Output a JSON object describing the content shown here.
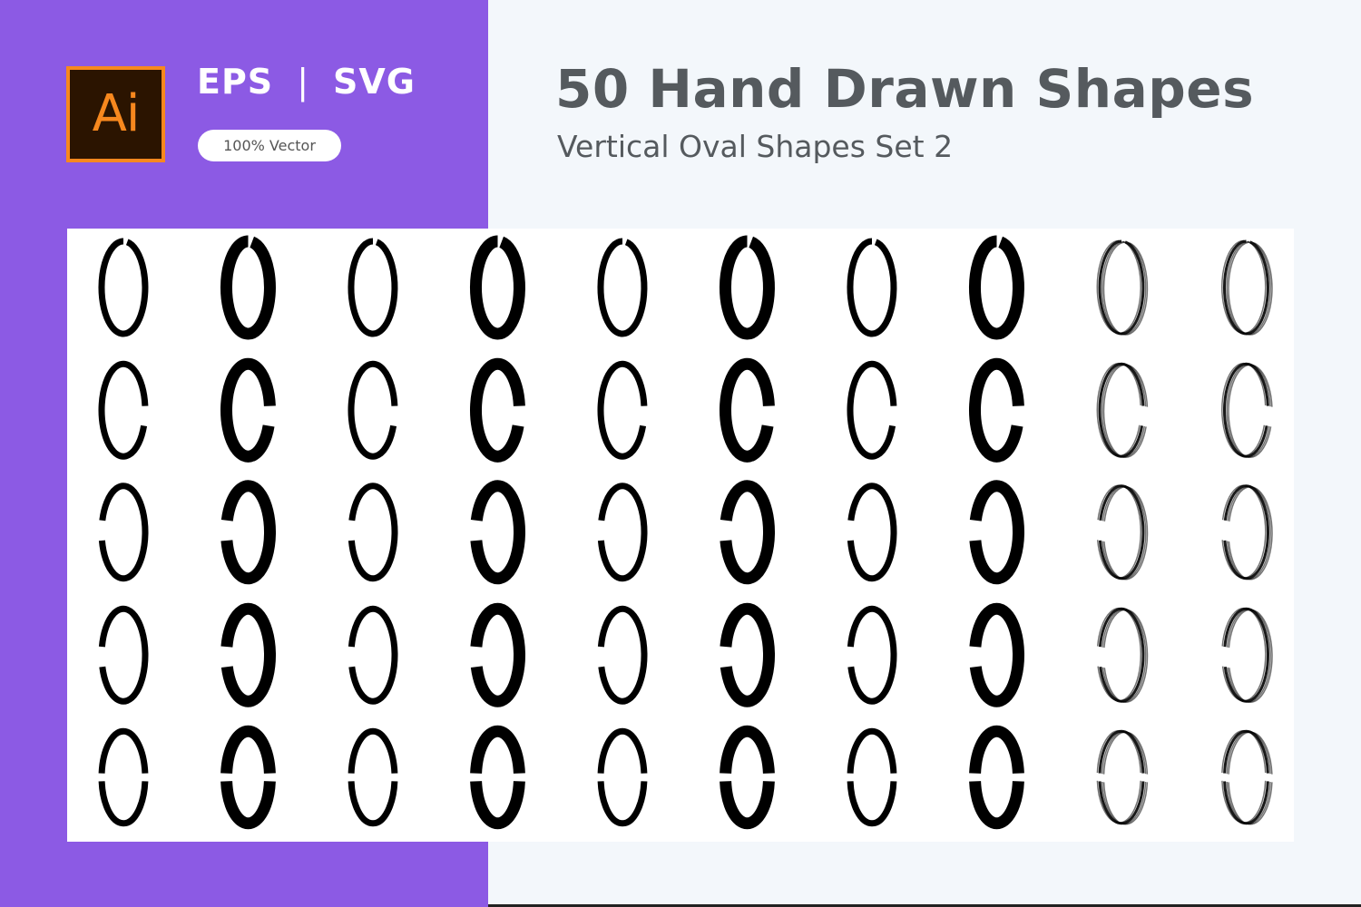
{
  "badge": {
    "logo_text": "Ai",
    "formats": [
      "EPS",
      "SVG"
    ],
    "separator": "|",
    "vector_pill": "100% Vector"
  },
  "header": {
    "title": "50 Hand Drawn Shapes",
    "subtitle": "Vertical Oval Shapes Set 2"
  },
  "colors": {
    "panel_purple": "#8c5ae4",
    "logo_orange": "#f7881e",
    "logo_dark": "#2b1400",
    "title_gray": "#555a5e",
    "page_bg": "#f3f7fb",
    "card_bg": "#ffffff",
    "shape_ink": "#000000"
  },
  "grid": {
    "rows": 5,
    "columns": 10,
    "shape_count": 50,
    "shape_type": "vertical-oval-brush-stroke",
    "column_styles": [
      "thin",
      "heavy",
      "thin-open",
      "heavy-open",
      "thin",
      "heavy-open",
      "thin",
      "heavy-open",
      "sketchy-light",
      "sketchy-multi"
    ],
    "row_styles": [
      "closed",
      "open-right",
      "open-left",
      "open-left-lower",
      "split-sides"
    ]
  }
}
